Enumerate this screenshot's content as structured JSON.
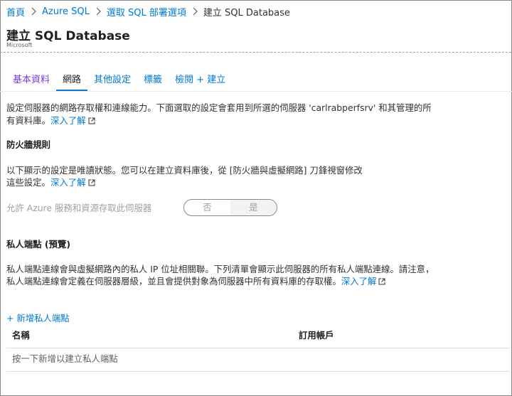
{
  "breadcrumb": {
    "items": [
      "首頁",
      "Azure SQL",
      "選取 SQL 部署選項"
    ],
    "current": "建立 SQL Database"
  },
  "header": {
    "title": "建立 SQL Database",
    "subtitle": "Microsoft"
  },
  "tabs": [
    "基本資料",
    "網路",
    "其他設定",
    "標籤",
    "檢閱 + 建立"
  ],
  "active_tab": "網路",
  "intro": {
    "line1": "設定伺服器的網路存取權和連線能力。下面選取的設定會套用到所選的伺服器 'carlrabperfsrv' 和其管理的所",
    "line2": "有資料庫。",
    "link": "深入了解"
  },
  "firewall": {
    "heading": "防火牆規則",
    "line1": "以下顯示的設定是唯讀狀態。您可以在建立資料庫後，從 [防火牆與虛擬網路] 刀鋒視窗修改",
    "line2": "這些設定。",
    "link": "深入了解",
    "toggle_label": "允許 Azure 服務和資源存取此伺服器",
    "toggle_no": "否",
    "toggle_yes": "是",
    "toggle_selected": "是"
  },
  "private_endpoint": {
    "heading": "私人端點 (預覽)",
    "line1": "私人端點連線會與虛擬網路內的私人 IP 位址相關聯。下列清單會顯示此伺服器的所有私人端點連線。請注意，",
    "line2": "私人端點連線會定義在伺服器層級，並且會提供對象為伺服器中所有資料庫的存取權。",
    "link": "深入了解",
    "add_label": "+ 新增私人端點",
    "columns": [
      "名稱",
      "訂用帳戶"
    ],
    "empty_text": "按一下新增以建立私人端點"
  },
  "colors": {
    "accent": "#0078d4",
    "visited": "#773adc",
    "text": "#323130",
    "disabled": "#a19f9d"
  }
}
